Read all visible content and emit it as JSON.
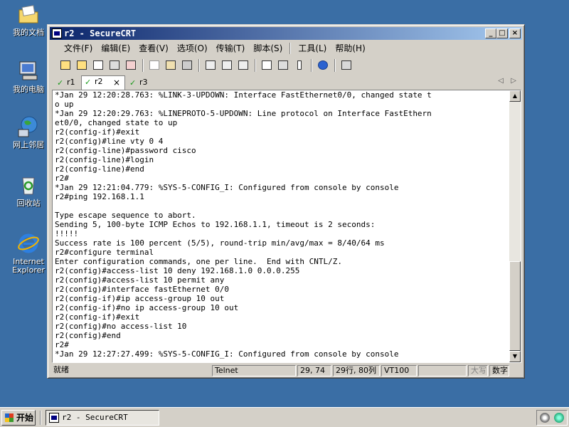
{
  "desktop": {
    "icons": [
      {
        "label": "我的文档"
      },
      {
        "label": "我的电脑"
      },
      {
        "label": "网上邻居"
      },
      {
        "label": "回收站"
      },
      {
        "label": "Internet\nExplorer"
      }
    ]
  },
  "window": {
    "title": "r2 - SecureCRT",
    "buttons": {
      "minimize": "_",
      "maximize": "□",
      "close": "×"
    }
  },
  "menu": {
    "items": [
      "文件(F)",
      "编辑(E)",
      "查看(V)",
      "选项(O)",
      "传输(T)",
      "脚本(S)",
      "工具(L)",
      "帮助(H)"
    ]
  },
  "tabs": [
    {
      "label": "r1",
      "check": "✓"
    },
    {
      "label": "r2",
      "check": "✓",
      "close": "×"
    },
    {
      "label": "r3",
      "check": "✓"
    }
  ],
  "tabnav": {
    "left": "◁",
    "right": "▷"
  },
  "terminal": {
    "lines": "*Jan 29 12:20:28.763: %LINK-3-UPDOWN: Interface FastEthernet0/0, changed state t\no up\n*Jan 29 12:20:29.763: %LINEPROTO-5-UPDOWN: Line protocol on Interface FastEthern\net0/0, changed state to up\nr2(config-if)#exit\nr2(config)#line vty 0 4\nr2(config-line)#password cisco\nr2(config-line)#login\nr2(config-line)#end\nr2#\n*Jan 29 12:21:04.779: %SYS-5-CONFIG_I: Configured from console by console\nr2#ping 192.168.1.1\n\nType escape sequence to abort.\nSending 5, 100-byte ICMP Echos to 192.168.1.1, timeout is 2 seconds:\n!!!!!\nSuccess rate is 100 percent (5/5), round-trip min/avg/max = 8/40/64 ms\nr2#configure terminal\nEnter configuration commands, one per line.  End with CNTL/Z.\nr2(config)#access-list 10 deny 192.168.1.0 0.0.0.255\nr2(config)#access-list 10 permit any\nr2(config)#interface fastEthernet 0/0\nr2(config-if)#ip access-group 10 out\nr2(config-if)#no ip access-group 10 out\nr2(config-if)#exit\nr2(config)#no access-list 10\nr2(config)#end\nr2#\n*Jan 29 12:27:27.499: %SYS-5-CONFIG_I: Configured from console by console"
  },
  "scrollbar": {
    "up": "▲",
    "down": "▼"
  },
  "status": {
    "ready": "就绪",
    "protocol": "Telnet",
    "cursor": "29, 74",
    "size": "29行, 80列",
    "emulation": "VT100",
    "caps": "大写",
    "num": "数字"
  },
  "taskbar": {
    "start": "开始",
    "task_title": "r2 - SecureCRT"
  },
  "colors": {
    "desktop": "#3a6ea5",
    "titlebar_start": "#0a246a",
    "titlebar_end": "#a6caf0"
  }
}
